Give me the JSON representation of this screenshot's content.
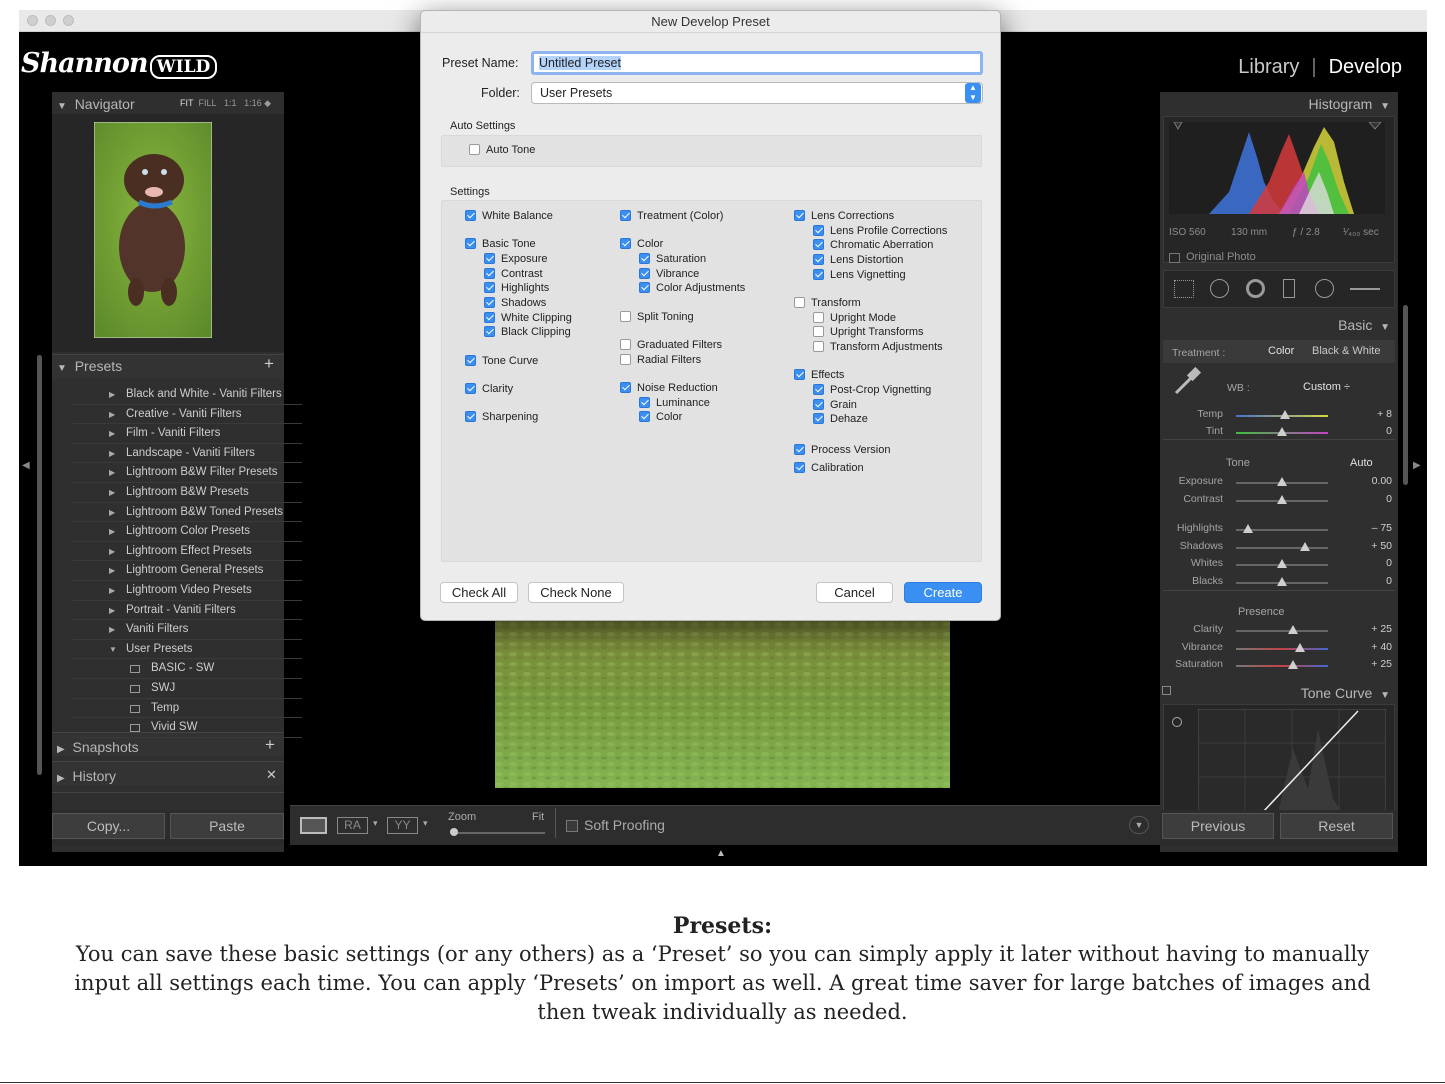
{
  "logo": {
    "text_a": "Shannon",
    "text_b": "WILD"
  },
  "modules": {
    "library": "Library",
    "develop": "Develop"
  },
  "navigator": {
    "title": "Navigator",
    "zoom_opts": [
      "FIT",
      "FILL",
      "1:1",
      "1:16 ◆"
    ]
  },
  "presets": {
    "title": "Presets",
    "items": [
      "Black and White - Vaniti Filters",
      "Creative - Vaniti Filters",
      "Film - Vaniti Filters",
      "Landscape - Vaniti Filters",
      "Lightroom B&W Filter Presets",
      "Lightroom B&W Presets",
      "Lightroom B&W Toned Presets",
      "Lightroom Color Presets",
      "Lightroom Effect Presets",
      "Lightroom General Presets",
      "Lightroom Video Presets",
      "Portrait - Vaniti Filters",
      "Vaniti Filters",
      "User Presets"
    ],
    "user_children": [
      "BASIC - SW",
      "SWJ",
      "Temp",
      "Vivid SW"
    ]
  },
  "snapshots": {
    "title": "Snapshots"
  },
  "history": {
    "title": "History"
  },
  "left_buttons": {
    "copy": "Copy...",
    "paste": "Paste"
  },
  "toolbar": {
    "zoom": "Zoom",
    "fit": "Fit",
    "soft_proofing": "Soft Proofing",
    "ra": "RA",
    "yy": "YY"
  },
  "histogram": {
    "title": "Histogram",
    "iso": "ISO 560",
    "focal": "130 mm",
    "aperture": "ƒ / 2.8",
    "shutter": "¹⁄₄₀₀ sec",
    "original_photo": "Original Photo"
  },
  "basic": {
    "title": "Basic",
    "treatment_label": "Treatment :",
    "color": "Color",
    "bw": "Black & White",
    "wb_label": "WB :",
    "wb_value": "Custom ÷",
    "tone_label": "Tone",
    "auto": "Auto",
    "presence_label": "Presence",
    "sliders": [
      {
        "name": "Temp",
        "value": "+ 8",
        "pos": 0.53
      },
      {
        "name": "Tint",
        "value": "0",
        "pos": 0.5
      },
      {
        "name": "Exposure",
        "value": "0.00",
        "pos": 0.5
      },
      {
        "name": "Contrast",
        "value": "0",
        "pos": 0.5
      },
      {
        "name": "Highlights",
        "value": "– 75",
        "pos": 0.13
      },
      {
        "name": "Shadows",
        "value": "+ 50",
        "pos": 0.75
      },
      {
        "name": "Whites",
        "value": "0",
        "pos": 0.5
      },
      {
        "name": "Blacks",
        "value": "0",
        "pos": 0.5
      },
      {
        "name": "Clarity",
        "value": "+ 25",
        "pos": 0.62
      },
      {
        "name": "Vibrance",
        "value": "+ 40",
        "pos": 0.7
      },
      {
        "name": "Saturation",
        "value": "+ 25",
        "pos": 0.62
      }
    ]
  },
  "tone_curve": {
    "title": "Tone Curve"
  },
  "right_buttons": {
    "previous": "Previous",
    "reset": "Reset"
  },
  "dialog": {
    "title": "New Develop Preset",
    "preset_name_label": "Preset Name:",
    "preset_name_value": "Untitled Preset",
    "folder_label": "Folder:",
    "folder_value": "User Presets",
    "auto_settings": "Auto Settings",
    "auto_tone": "Auto Tone",
    "settings": "Settings",
    "col1": [
      {
        "label": "White Balance",
        "checked": true,
        "level": 0
      },
      {
        "label": "Basic Tone",
        "checked": true,
        "level": 0
      },
      {
        "label": "Exposure",
        "checked": true,
        "level": 1
      },
      {
        "label": "Contrast",
        "checked": true,
        "level": 1
      },
      {
        "label": "Highlights",
        "checked": true,
        "level": 1
      },
      {
        "label": "Shadows",
        "checked": true,
        "level": 1
      },
      {
        "label": "White Clipping",
        "checked": true,
        "level": 1
      },
      {
        "label": "Black Clipping",
        "checked": true,
        "level": 1
      },
      {
        "label": "Tone Curve",
        "checked": true,
        "level": 0
      },
      {
        "label": "Clarity",
        "checked": true,
        "level": 0
      },
      {
        "label": "Sharpening",
        "checked": true,
        "level": 0
      }
    ],
    "col2": [
      {
        "label": "Treatment (Color)",
        "checked": true,
        "level": 0
      },
      {
        "label": "Color",
        "checked": true,
        "level": 0
      },
      {
        "label": "Saturation",
        "checked": true,
        "level": 1
      },
      {
        "label": "Vibrance",
        "checked": true,
        "level": 1
      },
      {
        "label": "Color Adjustments",
        "checked": true,
        "level": 1
      },
      {
        "label": "Split Toning",
        "checked": false,
        "level": 0
      },
      {
        "label": "Graduated Filters",
        "checked": false,
        "level": 0
      },
      {
        "label": "Radial Filters",
        "checked": false,
        "level": 0
      },
      {
        "label": "Noise Reduction",
        "checked": true,
        "level": 0
      },
      {
        "label": "Luminance",
        "checked": true,
        "level": 1
      },
      {
        "label": "Color",
        "checked": true,
        "level": 1
      }
    ],
    "col3": [
      {
        "label": "Lens Corrections",
        "checked": true,
        "level": 0
      },
      {
        "label": "Lens Profile Corrections",
        "checked": true,
        "level": 1
      },
      {
        "label": "Chromatic Aberration",
        "checked": true,
        "level": 1
      },
      {
        "label": "Lens Distortion",
        "checked": true,
        "level": 1
      },
      {
        "label": "Lens Vignetting",
        "checked": true,
        "level": 1
      },
      {
        "label": "Transform",
        "checked": false,
        "level": 0
      },
      {
        "label": "Upright Mode",
        "checked": false,
        "level": 1
      },
      {
        "label": "Upright Transforms",
        "checked": false,
        "level": 1
      },
      {
        "label": "Transform Adjustments",
        "checked": false,
        "level": 1
      },
      {
        "label": "Effects",
        "checked": true,
        "level": 0
      },
      {
        "label": "Post-Crop Vignetting",
        "checked": true,
        "level": 1
      },
      {
        "label": "Grain",
        "checked": true,
        "level": 1
      },
      {
        "label": "Dehaze",
        "checked": true,
        "level": 1
      },
      {
        "label": "Process Version",
        "checked": true,
        "level": 0
      },
      {
        "label": "Calibration",
        "checked": true,
        "level": 0
      }
    ],
    "check_all": "Check All",
    "check_none": "Check None",
    "cancel": "Cancel",
    "create": "Create"
  },
  "caption": {
    "heading": "Presets:",
    "body": "You can save these basic settings (or any others) as a ‘Preset’ so you can simply apply it later without having to manually input all settings each time. You can apply ‘Presets’ on import as well.  A great time saver for large batches of images and then tweak individually as needed."
  }
}
